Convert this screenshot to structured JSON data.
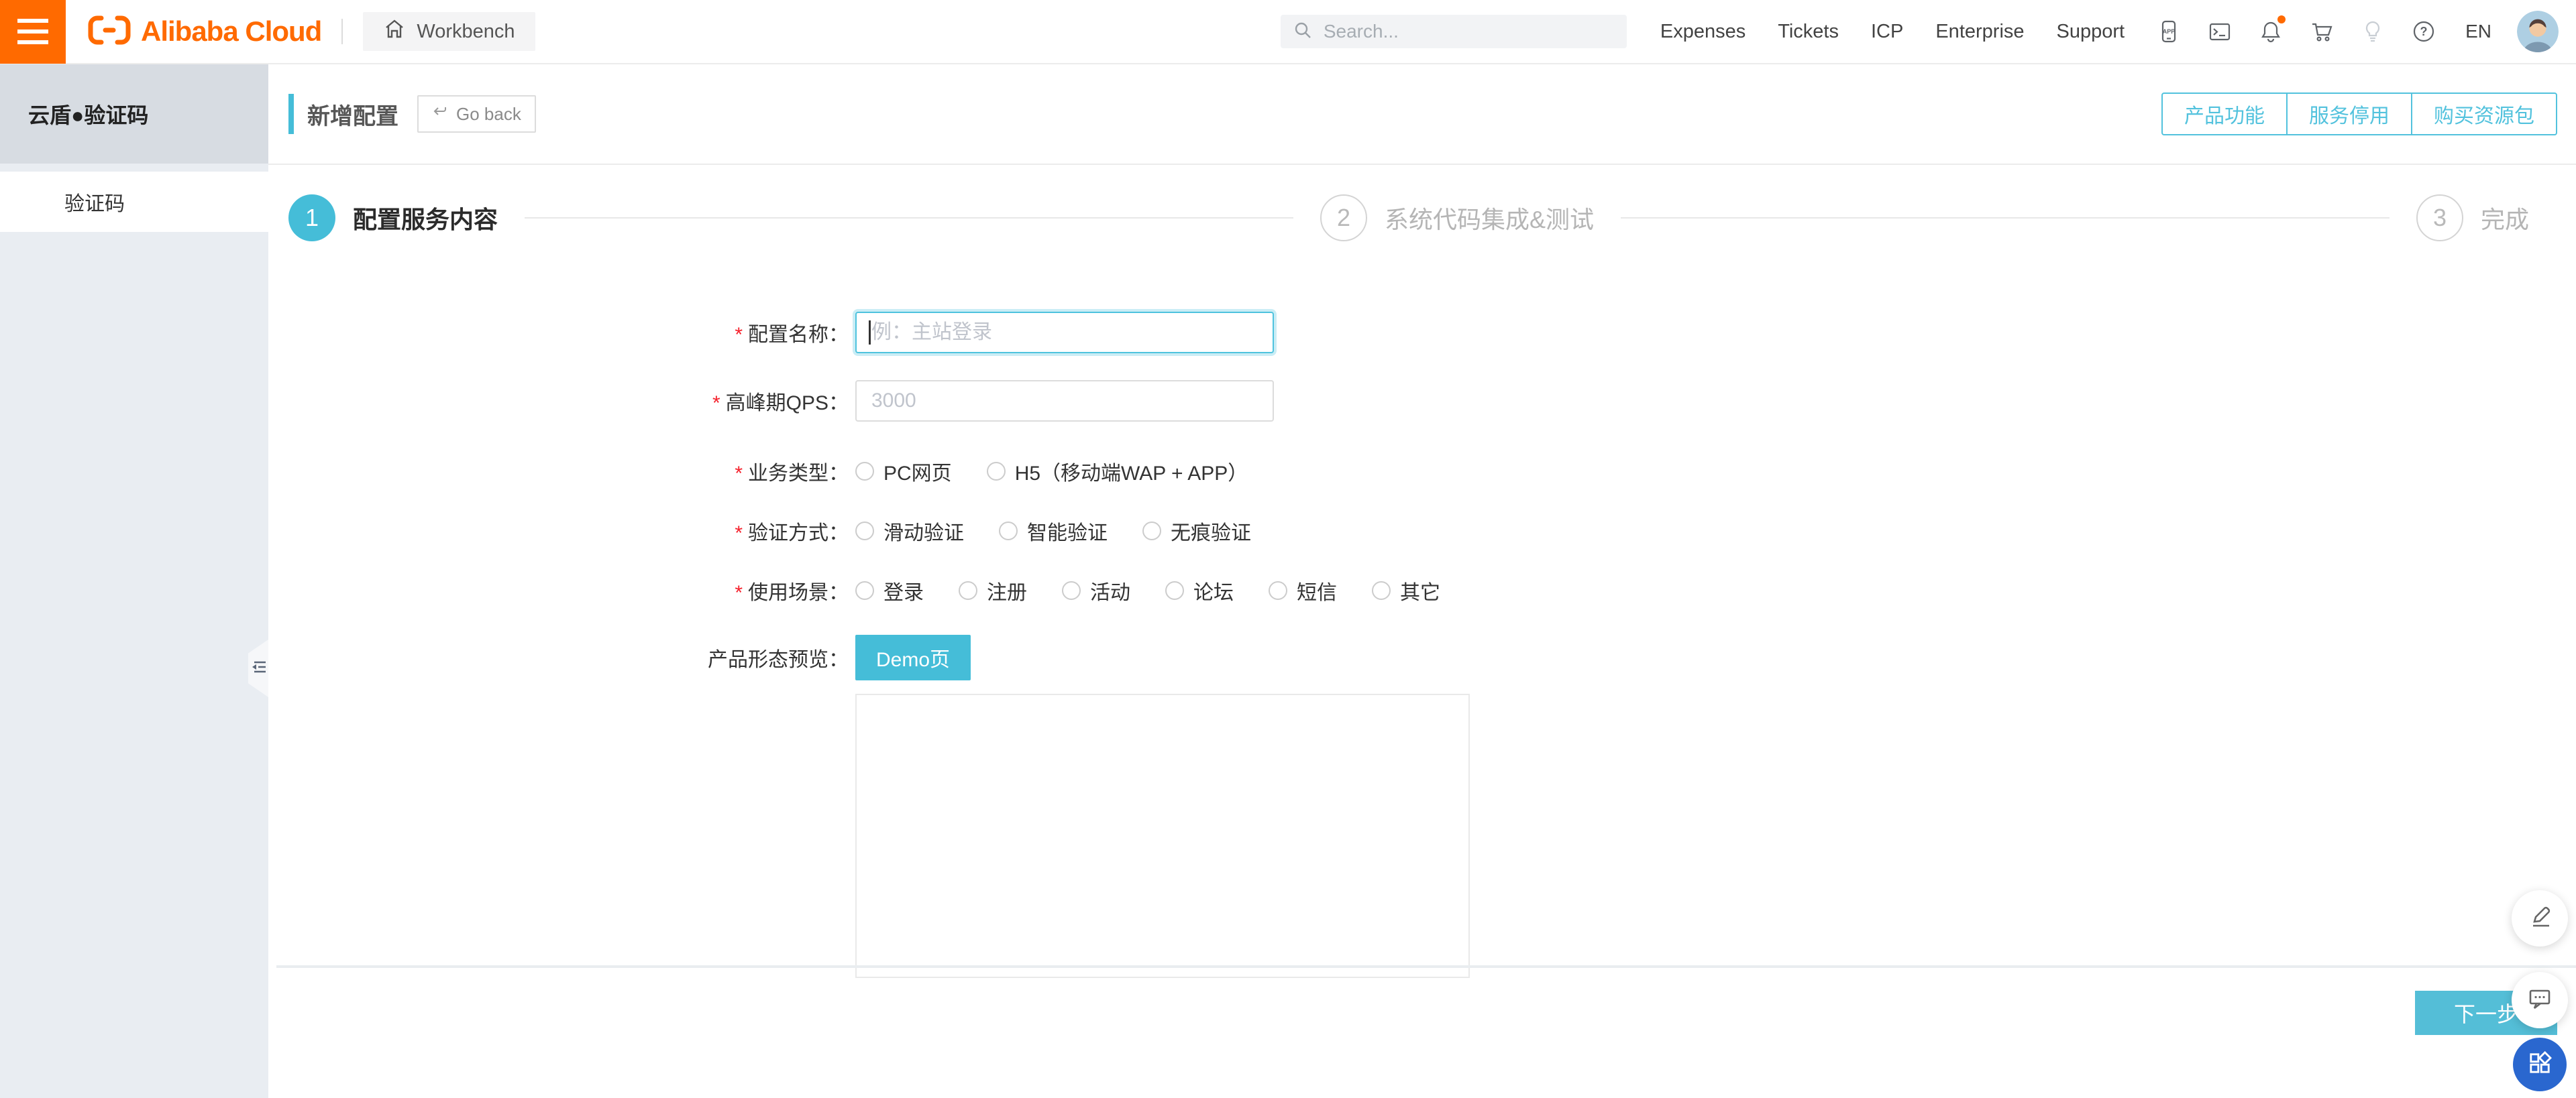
{
  "header": {
    "logo_text": "Alibaba Cloud",
    "workbench_label": "Workbench",
    "search_placeholder": "Search...",
    "links": [
      "Expenses",
      "Tickets",
      "ICP",
      "Enterprise",
      "Support"
    ],
    "icons": [
      "app-icon",
      "console-icon",
      "notification-icon",
      "cart-icon",
      "lightbulb-icon",
      "help-icon"
    ],
    "notification_has_badge": true,
    "language": "EN"
  },
  "sidebar": {
    "title": "云盾●验证码",
    "items": [
      {
        "label": "验证码",
        "active": true
      }
    ]
  },
  "page": {
    "title": "新增配置",
    "go_back_label": "Go back",
    "actions": [
      "产品功能",
      "服务停用",
      "购买资源包"
    ]
  },
  "steps": [
    {
      "number": "1",
      "label": "配置服务内容",
      "active": true
    },
    {
      "number": "2",
      "label": "系统代码集成&测试",
      "active": false
    },
    {
      "number": "3",
      "label": "完成",
      "active": false
    }
  ],
  "form": {
    "fields": [
      {
        "name": "config-name",
        "label": "配置名称：",
        "required": true,
        "type": "input",
        "placeholder": "例：主站登录",
        "value": "",
        "focused": true
      },
      {
        "name": "peak-qps",
        "label": "高峰期QPS：",
        "required": true,
        "type": "input",
        "placeholder": "3000",
        "value": "",
        "focused": false
      },
      {
        "name": "business-type",
        "label": "业务类型：",
        "required": true,
        "type": "radio",
        "options": [
          "PC网页",
          "H5（移动端WAP + APP）"
        ],
        "selected": null
      },
      {
        "name": "verify-mode",
        "label": "验证方式：",
        "required": true,
        "type": "radio",
        "options": [
          "滑动验证",
          "智能验证",
          "无痕验证"
        ],
        "selected": null
      },
      {
        "name": "usage-scene",
        "label": "使用场景：",
        "required": true,
        "type": "radio",
        "options": [
          "登录",
          "注册",
          "活动",
          "论坛",
          "短信",
          "其它"
        ],
        "selected": null
      },
      {
        "name": "product-preview",
        "label": "产品形态预览：",
        "required": false,
        "type": "demo",
        "button_label": "Demo页"
      }
    ],
    "next_button_label": "下一步"
  },
  "colors": {
    "accent_teal": "#45bdd8",
    "brand_orange": "#ff6a00",
    "fab_blue": "#2a67cf",
    "required_red": "#f5222d"
  }
}
